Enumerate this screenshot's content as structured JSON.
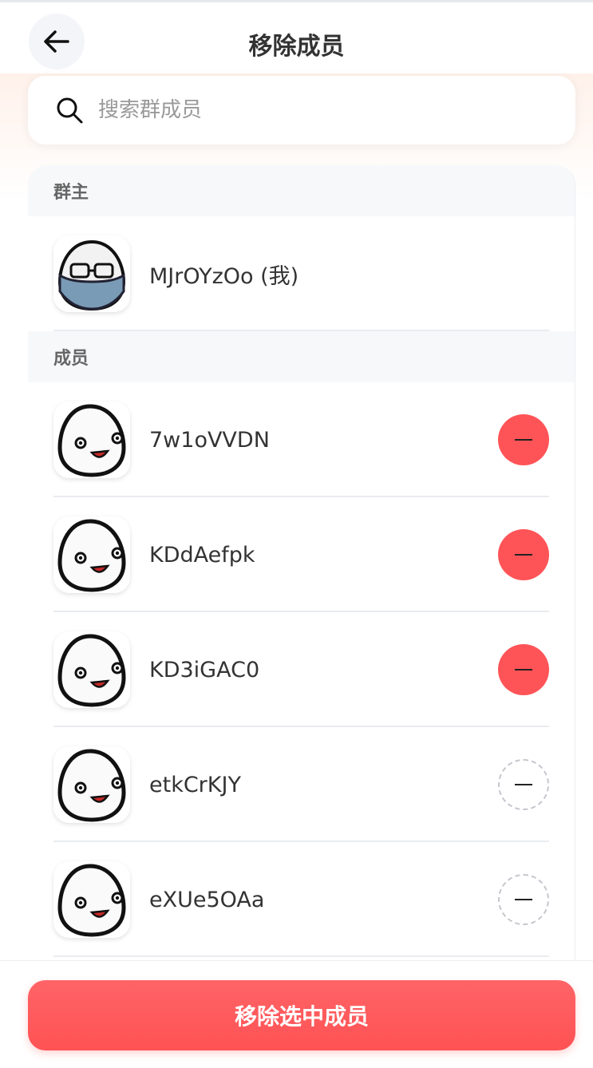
{
  "header": {
    "title": "移除成员",
    "back_icon": "arrow-left-icon"
  },
  "search": {
    "placeholder": "搜索群成员",
    "value": "",
    "icon": "search-icon"
  },
  "owner_section": {
    "label": "群主",
    "member": {
      "name": "MJrOYzOo (我)",
      "avatar": "masked-egg-avatar"
    }
  },
  "members_section": {
    "label": "成员",
    "members": [
      {
        "name": "7w1oVVDN",
        "selected": true
      },
      {
        "name": "KDdAefpk",
        "selected": true
      },
      {
        "name": "KD3iGAC0",
        "selected": true
      },
      {
        "name": "etkCrKJY",
        "selected": false
      },
      {
        "name": "eXUe5OAa",
        "selected": false
      }
    ]
  },
  "footer": {
    "submit_label": "移除选中成员"
  },
  "colors": {
    "accent": "#ff5457",
    "section_bg": "#f7f8fa",
    "divider": "#e9ebef"
  }
}
